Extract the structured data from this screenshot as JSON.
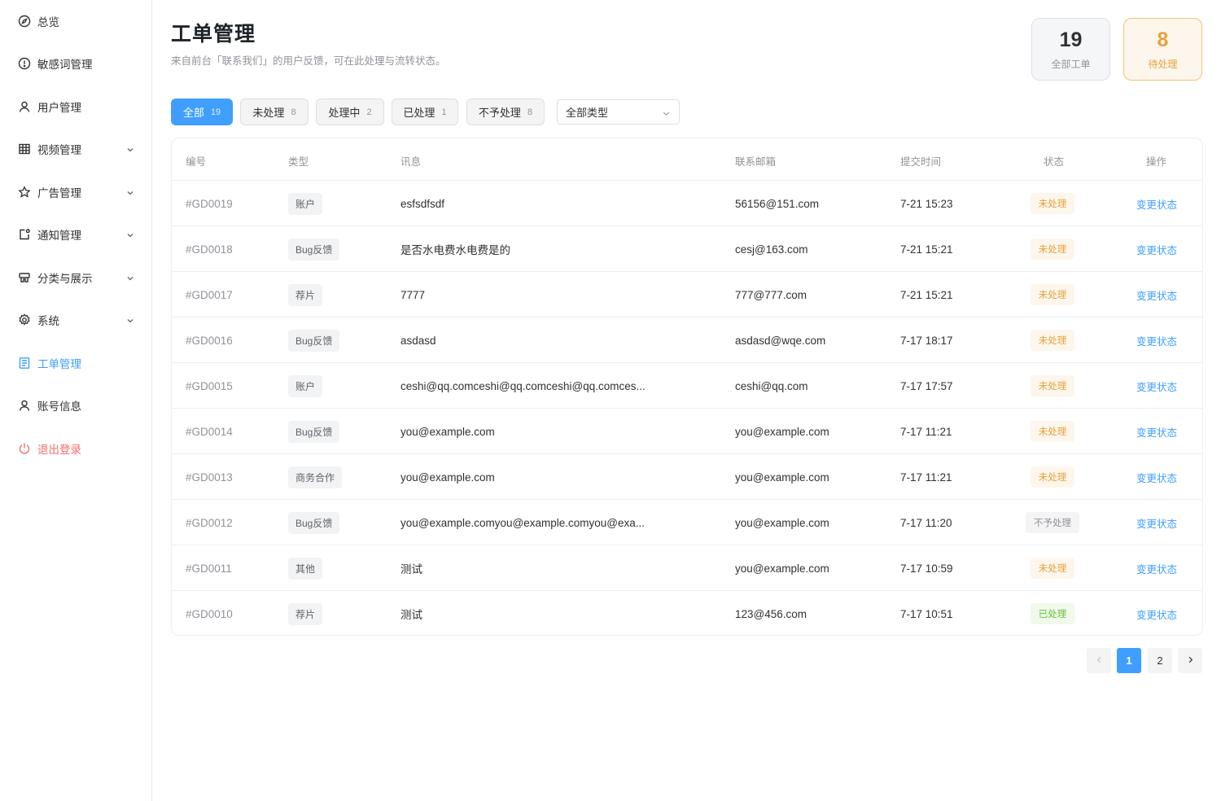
{
  "sidebar": {
    "items": [
      {
        "label": "总览",
        "icon": "compass-icon"
      },
      {
        "label": "敏感词管理",
        "icon": "alert-circle-icon"
      },
      {
        "label": "用户管理",
        "icon": "user-icon"
      },
      {
        "label": "视频管理",
        "icon": "grid-icon",
        "expandable": true
      },
      {
        "label": "广告管理",
        "icon": "star-icon",
        "expandable": true
      },
      {
        "label": "通知管理",
        "icon": "notification-icon",
        "expandable": true
      },
      {
        "label": "分类与展示",
        "icon": "layout-icon",
        "expandable": true
      },
      {
        "label": "系统",
        "icon": "gear-icon",
        "expandable": true
      },
      {
        "label": "工单管理",
        "icon": "document-icon",
        "active": true
      },
      {
        "label": "账号信息",
        "icon": "user-icon"
      },
      {
        "label": "退出登录",
        "icon": "power-icon",
        "danger": true
      }
    ]
  },
  "header": {
    "title": "工单管理",
    "subtitle": "来自前台「联系我们」的用户反馈，可在此处理与流转状态。"
  },
  "stats": {
    "all": {
      "value": "19",
      "label": "全部工单"
    },
    "pending": {
      "value": "8",
      "label": "待处理"
    }
  },
  "filters": {
    "tabs": [
      {
        "label": "全部",
        "count": "19",
        "active": true
      },
      {
        "label": "未处理",
        "count": "8"
      },
      {
        "label": "处理中",
        "count": "2"
      },
      {
        "label": "已处理",
        "count": "1"
      },
      {
        "label": "不予处理",
        "count": "8"
      }
    ],
    "type_select": "全部类型"
  },
  "table": {
    "headers": {
      "id": "编号",
      "type": "类型",
      "message": "讯息",
      "email": "联系邮箱",
      "time": "提交时间",
      "status": "状态",
      "op": "操作"
    },
    "rows": [
      {
        "id": "#GD0019",
        "type": "账户",
        "message": "esfsdfsdf",
        "email": "56156@151.com",
        "time": "7-21 15:23",
        "status": "未处理",
        "status_kind": "pending",
        "op": "变更状态"
      },
      {
        "id": "#GD0018",
        "type": "Bug反馈",
        "message": "是否水电费水电费是的",
        "email": "cesj@163.com",
        "time": "7-21 15:21",
        "status": "未处理",
        "status_kind": "pending",
        "op": "变更状态"
      },
      {
        "id": "#GD0017",
        "type": "荐片",
        "message": "7777",
        "email": "777@777.com",
        "time": "7-21 15:21",
        "status": "未处理",
        "status_kind": "pending",
        "op": "变更状态"
      },
      {
        "id": "#GD0016",
        "type": "Bug反馈",
        "message": "asdasd",
        "email": "asdasd@wqe.com",
        "time": "7-17 18:17",
        "status": "未处理",
        "status_kind": "pending",
        "op": "变更状态"
      },
      {
        "id": "#GD0015",
        "type": "账户",
        "message": "ceshi@qq.comceshi@qq.comceshi@qq.comces...",
        "email": "ceshi@qq.com",
        "time": "7-17 17:57",
        "status": "未处理",
        "status_kind": "pending",
        "op": "变更状态"
      },
      {
        "id": "#GD0014",
        "type": "Bug反馈",
        "message": "you@example.com",
        "email": "you@example.com",
        "time": "7-17 11:21",
        "status": "未处理",
        "status_kind": "pending",
        "op": "变更状态"
      },
      {
        "id": "#GD0013",
        "type": "商务合作",
        "message": "you@example.com",
        "email": "you@example.com",
        "time": "7-17 11:21",
        "status": "未处理",
        "status_kind": "pending",
        "op": "变更状态"
      },
      {
        "id": "#GD0012",
        "type": "Bug反馈",
        "message": "you@example.comyou@example.comyou@exa...",
        "email": "you@example.com",
        "time": "7-17 11:20",
        "status": "不予处理",
        "status_kind": "reject",
        "op": "变更状态"
      },
      {
        "id": "#GD0011",
        "type": "其他",
        "message": "测试",
        "email": "you@example.com",
        "time": "7-17 10:59",
        "status": "未处理",
        "status_kind": "pending",
        "op": "变更状态"
      },
      {
        "id": "#GD0010",
        "type": "荐片",
        "message": "测试",
        "email": "123@456.com",
        "time": "7-17 10:51",
        "status": "已处理",
        "status_kind": "done",
        "op": "变更状态"
      }
    ]
  },
  "pagination": {
    "pages": [
      "1",
      "2"
    ],
    "current": "1"
  },
  "colors": {
    "primary": "#409eff",
    "warning": "#e6a23c",
    "success": "#67c23a",
    "danger": "#f56c6c"
  }
}
